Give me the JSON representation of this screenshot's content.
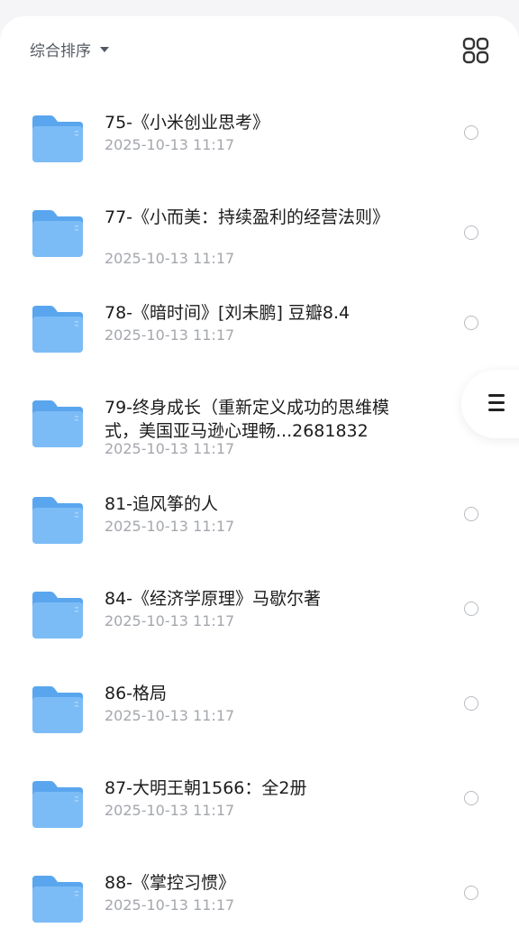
{
  "toolbar": {
    "sort_label": "综合排序",
    "sort_icon": "caret-down-icon",
    "view_icon": "grid-view-icon"
  },
  "colors": {
    "folder_front": "#7cbcf6",
    "folder_back": "#5aa6ee",
    "title_text": "#1c1c1e",
    "date_text": "#a4a7ad"
  },
  "files": [
    {
      "name": "75-《小米创业思考》",
      "date": "2025-10-13 11:17"
    },
    {
      "name": "77-《小而美：持续盈利的经营法则》",
      "date": "2025-10-13 11:17"
    },
    {
      "name": "78-《暗时间》[刘未鹏] 豆瓣8.4",
      "date": "2025-10-13 11:17"
    },
    {
      "name": "79-终身成长（重新定义成功的思维模式，美国亚马逊心理畅...2681832",
      "date": "2025-10-13 11:17"
    },
    {
      "name": "81-追风筝的人",
      "date": "2025-10-13 11:17"
    },
    {
      "name": "84-《经济学原理》马歇尔著",
      "date": "2025-10-13 11:17"
    },
    {
      "name": "86-格局",
      "date": "2025-10-13 11:17"
    },
    {
      "name": "87-大明王朝1566：全2册",
      "date": "2025-10-13 11:17"
    },
    {
      "name": "88-《掌控习惯》",
      "date": "2025-10-13 11:17"
    }
  ],
  "side_handle_icon": "menu-icon"
}
